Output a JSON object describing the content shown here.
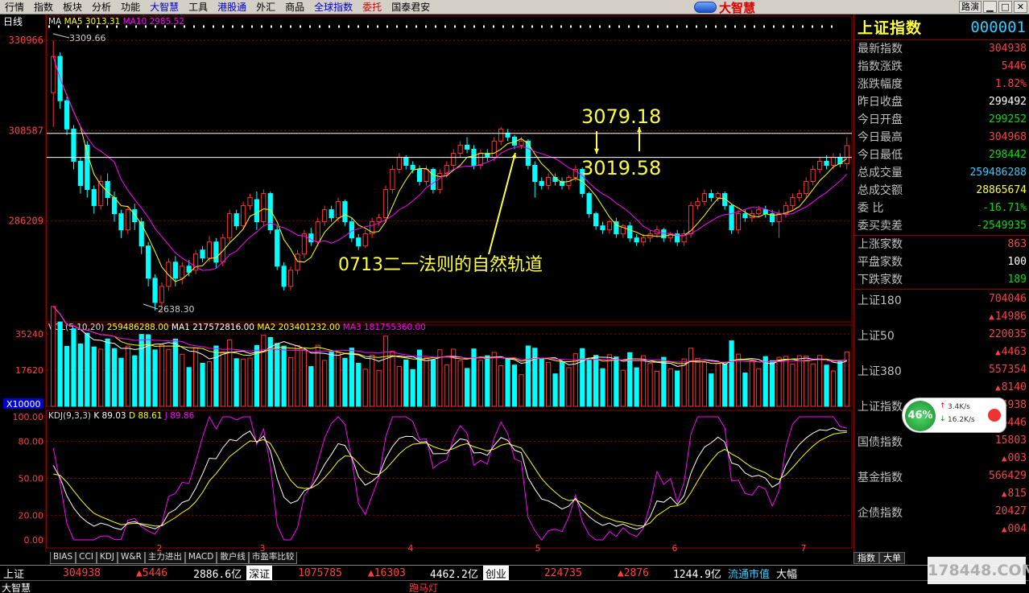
{
  "menu": [
    {
      "label": "行情",
      "c": ""
    },
    {
      "label": "指数",
      "c": ""
    },
    {
      "label": "板块",
      "c": ""
    },
    {
      "label": "分析",
      "c": ""
    },
    {
      "label": "功能",
      "c": ""
    },
    {
      "label": "大智慧",
      "c": "blue"
    },
    {
      "label": "工具",
      "c": ""
    },
    {
      "label": "港股通",
      "c": "blue"
    },
    {
      "label": "外汇",
      "c": ""
    },
    {
      "label": "商品",
      "c": ""
    },
    {
      "label": "全球指数",
      "c": "blue"
    },
    {
      "label": "委托",
      "c": "red"
    },
    {
      "label": "国泰君安",
      "c": ""
    }
  ],
  "logo_text": "大智慧",
  "window_buttons": [
    "路演",
    "▁",
    "□",
    "✕"
  ],
  "chart_data": {
    "type": "candlestick",
    "period_label": "日线",
    "ma_legend": {
      "label": "MA",
      "ma5": "MA5 3013.31",
      "ma10": "MA10 2985.52"
    },
    "y_ticks": [
      "330966",
      "308587",
      "286209"
    ],
    "y_tick_values": [
      3309.66,
      3085.87,
      2862.09
    ],
    "ylim": [
      2620,
      3330
    ],
    "x_ticks": [
      "2",
      "3",
      "4",
      "5",
      "6",
      "7"
    ],
    "high_label": "3309.66",
    "low_label": "2638.30",
    "ref_lines": [
      3079.18,
      3019.58
    ],
    "annotations": {
      "upper": "3079.18",
      "lower": "3019.58",
      "trend": "0713二一法则的自然轨道"
    },
    "candles": [
      [
        3180,
        3270,
        3095,
        3309.7
      ],
      [
        3270,
        3160,
        3140,
        3280
      ],
      [
        3160,
        3090,
        3075,
        3170
      ],
      [
        3090,
        3010,
        2990,
        3100
      ],
      [
        3010,
        2950,
        2930,
        3020
      ],
      [
        3050,
        2940,
        2920,
        3060
      ],
      [
        2940,
        2900,
        2880,
        2950
      ],
      [
        2900,
        2960,
        2890,
        2975
      ],
      [
        2960,
        2920,
        2900,
        2980
      ],
      [
        2920,
        2880,
        2860,
        2935
      ],
      [
        2880,
        2840,
        2820,
        2890
      ],
      [
        2840,
        2890,
        2830,
        2900
      ],
      [
        2890,
        2860,
        2840,
        2905
      ],
      [
        2860,
        2800,
        2780,
        2870
      ],
      [
        2800,
        2720,
        2700,
        2810
      ],
      [
        2720,
        2660,
        2640,
        2730
      ],
      [
        2660,
        2700,
        2638.3,
        2710
      ],
      [
        2700,
        2760,
        2690,
        2770
      ],
      [
        2760,
        2720,
        2700,
        2775
      ],
      [
        2720,
        2750,
        2705,
        2760
      ],
      [
        2750,
        2735,
        2725,
        2765
      ],
      [
        2740,
        2780,
        2730,
        2790
      ],
      [
        2790,
        2770,
        2760,
        2800
      ],
      [
        2770,
        2810,
        2760,
        2825
      ],
      [
        2810,
        2760,
        2745,
        2820
      ],
      [
        2760,
        2820,
        2750,
        2830
      ],
      [
        2820,
        2880,
        2810,
        2890
      ],
      [
        2880,
        2850,
        2840,
        2890
      ],
      [
        2850,
        2900,
        2840,
        2910
      ],
      [
        2900,
        2920,
        2890,
        2930
      ],
      [
        2915,
        2860,
        2840,
        2935
      ],
      [
        2860,
        2930,
        2850,
        2940
      ],
      [
        2930,
        2840,
        2830,
        2935
      ],
      [
        2840,
        2750,
        2740,
        2850
      ],
      [
        2750,
        2700,
        2690,
        2760
      ],
      [
        2700,
        2740,
        2690,
        2750
      ],
      [
        2740,
        2780,
        2730,
        2790
      ],
      [
        2780,
        2830,
        2770,
        2840
      ],
      [
        2830,
        2810,
        2800,
        2845
      ],
      [
        2810,
        2860,
        2800,
        2870
      ],
      [
        2860,
        2890,
        2850,
        2900
      ],
      [
        2890,
        2870,
        2860,
        2900
      ],
      [
        2870,
        2910,
        2860,
        2920
      ],
      [
        2910,
        2860,
        2850,
        2915
      ],
      [
        2860,
        2820,
        2810,
        2870
      ],
      [
        2820,
        2800,
        2790,
        2830
      ],
      [
        2800,
        2830,
        2795,
        2840
      ],
      [
        2830,
        2860,
        2820,
        2870
      ],
      [
        2860,
        2870,
        2850,
        2880
      ],
      [
        2870,
        2940,
        2860,
        2950
      ],
      [
        2940,
        2990,
        2930,
        3000
      ],
      [
        2990,
        3020,
        2980,
        3030
      ],
      [
        3020,
        3000,
        2990,
        3025
      ],
      [
        3000,
        2990,
        2980,
        3010
      ],
      [
        2990,
        2960,
        2950,
        3000
      ],
      [
        2960,
        2990,
        2950,
        3000
      ],
      [
        2990,
        2940,
        2930,
        2995
      ],
      [
        2940,
        2980,
        2930,
        2990
      ],
      [
        2980,
        3000,
        2970,
        3010
      ],
      [
        3000,
        3030,
        2990,
        3040
      ],
      [
        3030,
        3050,
        3020,
        3060
      ],
      [
        3050,
        3040,
        3030,
        3070
      ],
      [
        3040,
        3000,
        2990,
        3050
      ],
      [
        3000,
        3030,
        2990,
        3040
      ],
      [
        3030,
        3020,
        3010,
        3040
      ],
      [
        3020,
        3060,
        3010,
        3070
      ],
      [
        3060,
        3090,
        3050,
        3095
      ],
      [
        3080,
        3070,
        3060,
        3090
      ],
      [
        3070,
        3050,
        3040,
        3075
      ],
      [
        3050,
        3060,
        3040,
        3070
      ],
      [
        3060,
        3000,
        2990,
        3065
      ],
      [
        3000,
        2960,
        2920,
        3010
      ],
      [
        2960,
        2950,
        2940,
        2970
      ],
      [
        2950,
        2970,
        2940,
        2980
      ],
      [
        2970,
        2960,
        2950,
        2980
      ],
      [
        2960,
        2950,
        2940,
        2970
      ],
      [
        2950,
        2970,
        2940,
        2975
      ],
      [
        2970,
        2990,
        2960,
        3000
      ],
      [
        2990,
        2930,
        2920,
        2995
      ],
      [
        2930,
        2880,
        2870,
        2935
      ],
      [
        2880,
        2850,
        2840,
        2885
      ],
      [
        2850,
        2840,
        2830,
        2860
      ],
      [
        2840,
        2860,
        2830,
        2865
      ],
      [
        2860,
        2830,
        2820,
        2870
      ],
      [
        2830,
        2850,
        2820,
        2855
      ],
      [
        2850,
        2820,
        2810,
        2860
      ],
      [
        2820,
        2810,
        2800,
        2830
      ],
      [
        2810,
        2820,
        2800,
        2830
      ],
      [
        2820,
        2830,
        2810,
        2840
      ],
      [
        2830,
        2840,
        2820,
        2850
      ],
      [
        2840,
        2820,
        2810,
        2845
      ],
      [
        2820,
        2830,
        2810,
        2835
      ],
      [
        2830,
        2810,
        2800,
        2840
      ],
      [
        2810,
        2830,
        2800,
        2840
      ],
      [
        2830,
        2900,
        2820,
        2910
      ],
      [
        2900,
        2910,
        2890,
        2920
      ],
      [
        2910,
        2930,
        2900,
        2940
      ],
      [
        2930,
        2920,
        2910,
        2940
      ],
      [
        2920,
        2930,
        2910,
        2935
      ],
      [
        2930,
        2900,
        2890,
        2935
      ],
      [
        2900,
        2840,
        2830,
        2905
      ],
      [
        2840,
        2880,
        2830,
        2890
      ],
      [
        2880,
        2870,
        2860,
        2890
      ],
      [
        2870,
        2880,
        2860,
        2890
      ],
      [
        2880,
        2890,
        2870,
        2900
      ],
      [
        2890,
        2880,
        2870,
        2900
      ],
      [
        2880,
        2860,
        2850,
        2890
      ],
      [
        2860,
        2880,
        2820,
        2890
      ],
      [
        2880,
        2900,
        2870,
        2910
      ],
      [
        2900,
        2920,
        2890,
        2930
      ],
      [
        2920,
        2930,
        2910,
        2940
      ],
      [
        2930,
        2960,
        2920,
        2970
      ],
      [
        2960,
        2990,
        2950,
        3000
      ],
      [
        2990,
        3010,
        2980,
        3020
      ],
      [
        3010,
        3000,
        2990,
        3025
      ],
      [
        3000,
        3020,
        2990,
        3030
      ],
      [
        3020,
        3004,
        2995,
        3030
      ],
      [
        3004,
        3049,
        2990,
        3070
      ]
    ],
    "volume": {
      "legend": "VOL(5,10,20)",
      "v": "259486288.00",
      "ma1": "MA1 217572816.00",
      "ma2": "MA2 203401232.00",
      "ma3": "MA3 181755360.00",
      "y_ticks": [
        "35240",
        "17620"
      ],
      "unit": "X10000",
      "ylim": [
        0,
        38000
      ]
    },
    "kdj": {
      "legend": "KDJ(9,3,3)",
      "k": "K 89.03",
      "d": "D 88.61",
      "j": "J 89.86",
      "y_ticks": [
        "100.00",
        "80.00",
        "50.00",
        "20.00",
        "0.00"
      ],
      "ylim": [
        0,
        100
      ]
    }
  },
  "side": {
    "name": "上证指数",
    "code": "000001",
    "rows": [
      {
        "k": "最新指数",
        "v": "304938",
        "c": "red"
      },
      {
        "k": "指数涨跌",
        "v": "5446",
        "c": "red"
      },
      {
        "k": "涨跌幅度",
        "v": "1.82%",
        "c": "red"
      },
      {
        "k": "昨日收盘",
        "v": "299492",
        "c": "wht"
      },
      {
        "k": "今日开盘",
        "v": "299252",
        "c": "grn"
      },
      {
        "k": "今日最高",
        "v": "304968",
        "c": "red"
      },
      {
        "k": "今日最低",
        "v": "298442",
        "c": "grn"
      },
      {
        "k": "总成交量",
        "v": "259486288",
        "c": "cyn"
      },
      {
        "k": "总成交额",
        "v": "28865674",
        "c": "yel"
      },
      {
        "k": "委    比",
        "v": "-16.71%",
        "c": "grn"
      },
      {
        "k": "委买卖差",
        "v": "-2549935",
        "c": "grn"
      }
    ],
    "rows2": [
      {
        "k": "上涨家数",
        "v": "863",
        "c": "red"
      },
      {
        "k": "平盘家数",
        "v": "100",
        "c": "wht"
      },
      {
        "k": "下跌家数",
        "v": "189",
        "c": "grn"
      }
    ],
    "indices": [
      {
        "k": "上证180",
        "v1": "704046",
        "v2": "14986"
      },
      {
        "k": "上证50",
        "v1": "220035",
        "v2": "4463"
      },
      {
        "k": "上证380",
        "v1": "557354",
        "v2": "8140"
      },
      {
        "k": "上证指数",
        "v1": "304938",
        "v2": "5446"
      },
      {
        "k": "国债指数",
        "v1": "15803",
        "v2": "003"
      },
      {
        "k": "基金指数",
        "v1": "566429",
        "v2": "815"
      },
      {
        "k": "企债指数",
        "v1": "20427",
        "v2": "004"
      }
    ],
    "tabs": [
      "指数",
      "大单"
    ]
  },
  "bottom_tabs": [
    "BIAS",
    "CCI",
    "KDJ",
    "W&R",
    "主力进出",
    "MACD",
    "散户线",
    "市盈率比较"
  ],
  "status": {
    "sh_label": "上证",
    "sh_val": "304938",
    "sh_chg": "▲5446",
    "sh_amt": "2886.6亿",
    "sz_label": "深证",
    "sz_val": "1075785",
    "sz_chg": "▲16303",
    "sz_amt": "4462.2亿",
    "cy_label": "创业",
    "cy_val": "224735",
    "cy_chg": "▲2876",
    "cy_amt": "1244.9亿",
    "flow": "流通市值",
    "big": "大幅"
  },
  "footer": {
    "app": "大智慧",
    "marquee": "跑马灯"
  },
  "net": {
    "pct": "46%",
    "up": "3.4K/s",
    "down": "16.2K/s"
  },
  "watermark": "178448.COM",
  "colors": {
    "up": "#ff3232",
    "down": "#00ffff",
    "ma5": "#ffffff",
    "ma10": "#ffff00",
    "ma20": "#ff00ff",
    "annot": "#ffff3c"
  }
}
